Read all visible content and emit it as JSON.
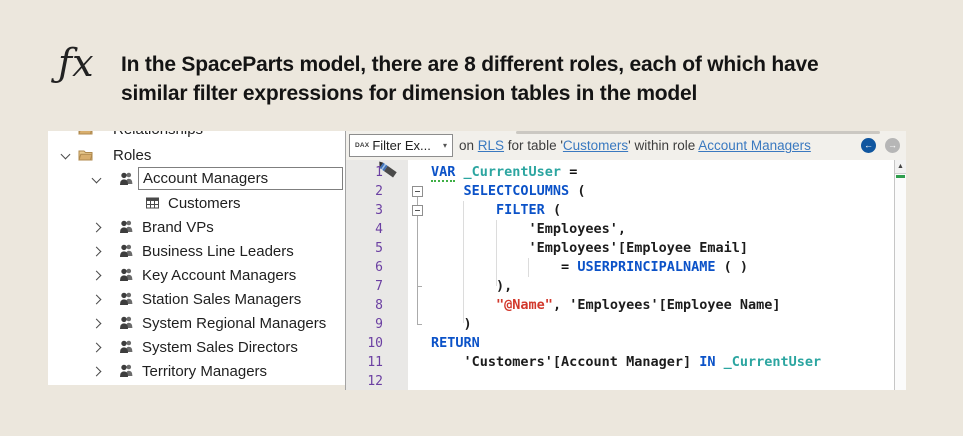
{
  "header": {
    "fx_glyph": "ƒx",
    "line1": "In the SpaceParts model, there are 8 different roles, each of which have",
    "line2": "similar filter expressions for dimension tables in the model"
  },
  "sidebar": {
    "clipped_item": {
      "label": "Relationships",
      "icon": "folder"
    },
    "items": [
      {
        "label": "Roles",
        "icon": "folder",
        "chevron": "down",
        "level": 0,
        "selected": false
      },
      {
        "label": "Account Managers",
        "icon": "role",
        "chevron": "down",
        "level": 1,
        "selected": true
      },
      {
        "label": "Customers",
        "icon": "table",
        "chevron": "none",
        "level": 2,
        "selected": false
      },
      {
        "label": "Brand VPs",
        "icon": "role",
        "chevron": "right",
        "level": 1,
        "selected": false
      },
      {
        "label": "Business Line Leaders",
        "icon": "role",
        "chevron": "right",
        "level": 1,
        "selected": false
      },
      {
        "label": "Key Account Managers",
        "icon": "role",
        "chevron": "right",
        "level": 1,
        "selected": false
      },
      {
        "label": "Station Sales Managers",
        "icon": "role",
        "chevron": "right",
        "level": 1,
        "selected": false
      },
      {
        "label": "System Regional Managers",
        "icon": "role",
        "chevron": "right",
        "level": 1,
        "selected": false
      },
      {
        "label": "System Sales Directors",
        "icon": "role",
        "chevron": "right",
        "level": 1,
        "selected": false
      },
      {
        "label": "Territory Managers",
        "icon": "role",
        "chevron": "right",
        "level": 1,
        "selected": false
      }
    ]
  },
  "toolbar": {
    "dax_badge": "DAX",
    "dropdown_label": "Filter Ex...",
    "context_segments": [
      {
        "text": "on "
      },
      {
        "text": "RLS",
        "link": true
      },
      {
        "text": " for table '"
      },
      {
        "text": "Customers",
        "link": true
      },
      {
        "text": "' within role "
      },
      {
        "text": "Account Managers",
        "link": true
      }
    ]
  },
  "icons": {
    "dropdown_arrow": "▾",
    "back_arrow": "←",
    "forward_arrow": "→",
    "scroll_up": "▲"
  },
  "code": {
    "lines": [
      {
        "num": "1",
        "segments": [
          {
            "t": "VAR",
            "c": "kw u"
          },
          {
            "t": " "
          },
          {
            "t": "_CurrentUser",
            "c": "var"
          },
          {
            "t": " "
          },
          {
            "t": "=",
            "c": "op"
          }
        ]
      },
      {
        "num": "2",
        "segments": [
          {
            "t": "    "
          },
          {
            "t": "SELECTCOLUMNS",
            "c": "kw"
          },
          {
            "t": " ("
          }
        ]
      },
      {
        "num": "3",
        "segments": [
          {
            "t": "        "
          },
          {
            "t": "FILTER",
            "c": "kw"
          },
          {
            "t": " ("
          }
        ]
      },
      {
        "num": "4",
        "segments": [
          {
            "t": "            'Employees',"
          }
        ]
      },
      {
        "num": "5",
        "segments": [
          {
            "t": "            'Employees'[Employee Email]"
          }
        ]
      },
      {
        "num": "6",
        "segments": [
          {
            "t": "                "
          },
          {
            "t": "=",
            "c": "op"
          },
          {
            "t": " "
          },
          {
            "t": "USERPRINCIPALNAME",
            "c": "kw"
          },
          {
            "t": " ( )"
          }
        ]
      },
      {
        "num": "7",
        "segments": [
          {
            "t": "        ),"
          }
        ]
      },
      {
        "num": "8",
        "segments": [
          {
            "t": "        "
          },
          {
            "t": "\"@Name\"",
            "c": "str"
          },
          {
            "t": ", 'Employees'[Employee Name]"
          }
        ]
      },
      {
        "num": "9",
        "segments": [
          {
            "t": "    )"
          }
        ]
      },
      {
        "num": "10",
        "segments": [
          {
            "t": "RETURN",
            "c": "kw"
          }
        ]
      },
      {
        "num": "11",
        "segments": [
          {
            "t": "    'Customers'[Account Manager] "
          },
          {
            "t": "IN",
            "c": "kw"
          },
          {
            "t": " "
          },
          {
            "t": "_CurrentUser",
            "c": "var"
          }
        ]
      },
      {
        "num": "12",
        "segments": [
          {
            "t": ""
          }
        ]
      }
    ]
  },
  "colors": {
    "background": "#ece7dd",
    "keyword_blue": "#0b52c8",
    "variable_teal": "#2ba5a0",
    "string_red": "#d2382c",
    "line_number_purple": "#6b3fa2",
    "link_blue": "#3a79c0",
    "back_button_blue": "#10569f",
    "folder_tan": "#d8ae6d",
    "scroll_marker_green": "#2f9e4e"
  }
}
